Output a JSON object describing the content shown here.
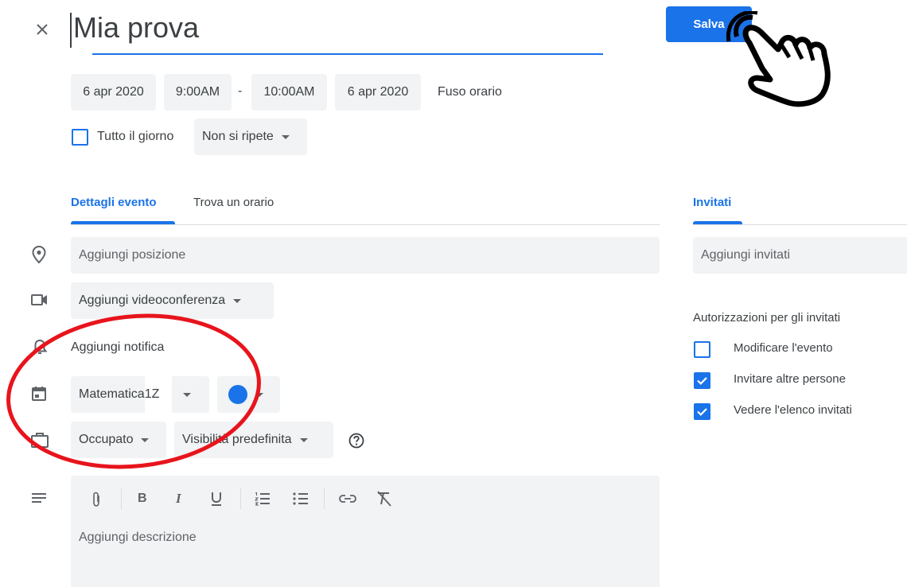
{
  "header": {
    "close_icon": "close-icon",
    "title": "Mia prova",
    "save_label": "Salva"
  },
  "datetime": {
    "start_date": "6 apr 2020",
    "start_time": "9:00AM",
    "separator": "-",
    "end_time": "10:00AM",
    "end_date": "6 apr 2020",
    "timezone": "Fuso orario",
    "all_day_label": "Tutto il giorno",
    "repeat": "Non si ripete"
  },
  "tabs": {
    "details": "Dettagli evento",
    "find_time": "Trova un orario",
    "guests": "Invitati"
  },
  "event": {
    "location_placeholder": "Aggiungi posizione",
    "conference": "Aggiungi videoconferenza",
    "notification": "Aggiungi notifica",
    "calendar": "Matematica",
    "calendar_suffix": "1Z",
    "calendar_color": "#1a73e8",
    "availability": "Occupato",
    "visibility": "Visibilità predefinita",
    "description_placeholder": "Aggiungi descrizione"
  },
  "guests": {
    "add_placeholder": "Aggiungi invitati",
    "permissions_title": "Autorizzazioni per gli invitati",
    "permissions": [
      {
        "label": "Modificare l'evento",
        "checked": false
      },
      {
        "label": "Invitare altre persone",
        "checked": true
      },
      {
        "label": "Vedere l'elenco invitati",
        "checked": true
      }
    ]
  },
  "toolbar_icons": [
    "attach-icon",
    "bold-icon",
    "italic-icon",
    "underline-icon",
    "numbered-list-icon",
    "bulleted-list-icon",
    "link-icon",
    "clear-format-icon"
  ],
  "colors": {
    "accent": "#1a73e8",
    "annotation": "#e8141c"
  }
}
